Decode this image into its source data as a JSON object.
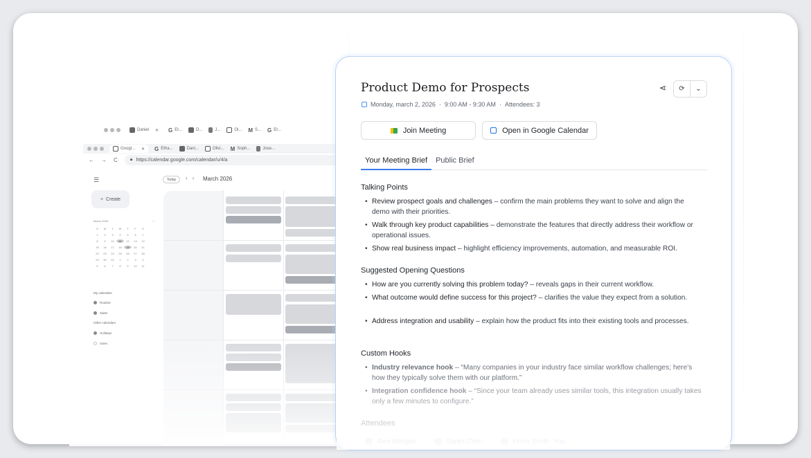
{
  "back_window": {
    "tabs": [
      "Daniel",
      "Et...",
      "D...",
      "J...",
      "Ol...",
      "S...",
      "Et..."
    ]
  },
  "front_window": {
    "tabs": [
      "Googl...",
      "Etha...",
      "Dani...",
      "Olivi...",
      "Soph...",
      "Jose..."
    ],
    "url": "https://calendar.google.com/calendar/u/4/a"
  },
  "calendar": {
    "create_label": "Create",
    "today_label": "Today",
    "month": "March 2026",
    "mini_title": "March 2026",
    "mini_days": [
      "S",
      "M",
      "T",
      "W",
      "T",
      "F",
      "S"
    ],
    "mini_dates": [
      "1",
      "2",
      "3",
      "4",
      "5",
      "6",
      "7",
      "8",
      "9",
      "10",
      "11",
      "12",
      "13",
      "14",
      "15",
      "16",
      "17",
      "18",
      "19",
      "20",
      "21",
      "22",
      "23",
      "24",
      "25",
      "26",
      "27",
      "28",
      "29",
      "30",
      "31",
      "1",
      "2",
      "3",
      "4",
      "5",
      "6",
      "7",
      "8",
      "9",
      "10",
      "11",
      "12",
      "13"
    ],
    "my_calendars": "My calendars",
    "my_items": [
      "Routine",
      "Sales"
    ],
    "other_calendars": "Other calendars",
    "other_items": [
      "Holidays",
      "Sales"
    ]
  },
  "brief": {
    "title": "Product Demo for Prospects",
    "date": "Monday, march 2, 2026",
    "time": "9:00 AM - 9:30 AM",
    "attendees_count": "Attendees: 3",
    "join_label": "Join Meeting",
    "open_label": "Open in Google Calendar",
    "tabs": [
      "Your Meeting Brief",
      "Public Brief"
    ],
    "talking_points_title": "Talking Points",
    "talking_points": [
      {
        "bold": "Review prospect goals and challenges",
        "rest": " – confirm the main problems they want to solve and align the demo with their priorities."
      },
      {
        "bold": "Walk through key product capabilities",
        "rest": " – demonstrate the features that directly address their workflow or operational issues."
      },
      {
        "bold": "Show real business impact",
        "rest": " – highlight efficiency improvements, automation, and measurable ROI."
      }
    ],
    "questions_title": "Suggested Opening Questions",
    "questions": [
      {
        "bold": "How are you currently solving this problem today?",
        "rest": " – reveals gaps in their current workflow."
      },
      {
        "bold": "What outcome would define success for this project?",
        "rest": " – clarifies the value they expect from a solution."
      },
      {
        "bold": "Address integration and usability",
        "rest": " – explain how the product fits into their existing tools and processes."
      }
    ],
    "hooks_title": "Custom Hooks",
    "hooks": [
      {
        "bold": "Industry relevance hook",
        "rest": " – “Many companies in your industry face similar workflow challenges; here’s how they typically solve them with our platform.”"
      },
      {
        "bold": "Integration confidence hook",
        "rest": " – “Since your team already uses similar tools, this integration usually takes only a few minutes to configure.”"
      }
    ],
    "attendees_title": "Attendees",
    "attendees": [
      "Alex Morgan",
      "Sarah Chen",
      "Kevin Smith"
    ],
    "you_label": "You"
  }
}
